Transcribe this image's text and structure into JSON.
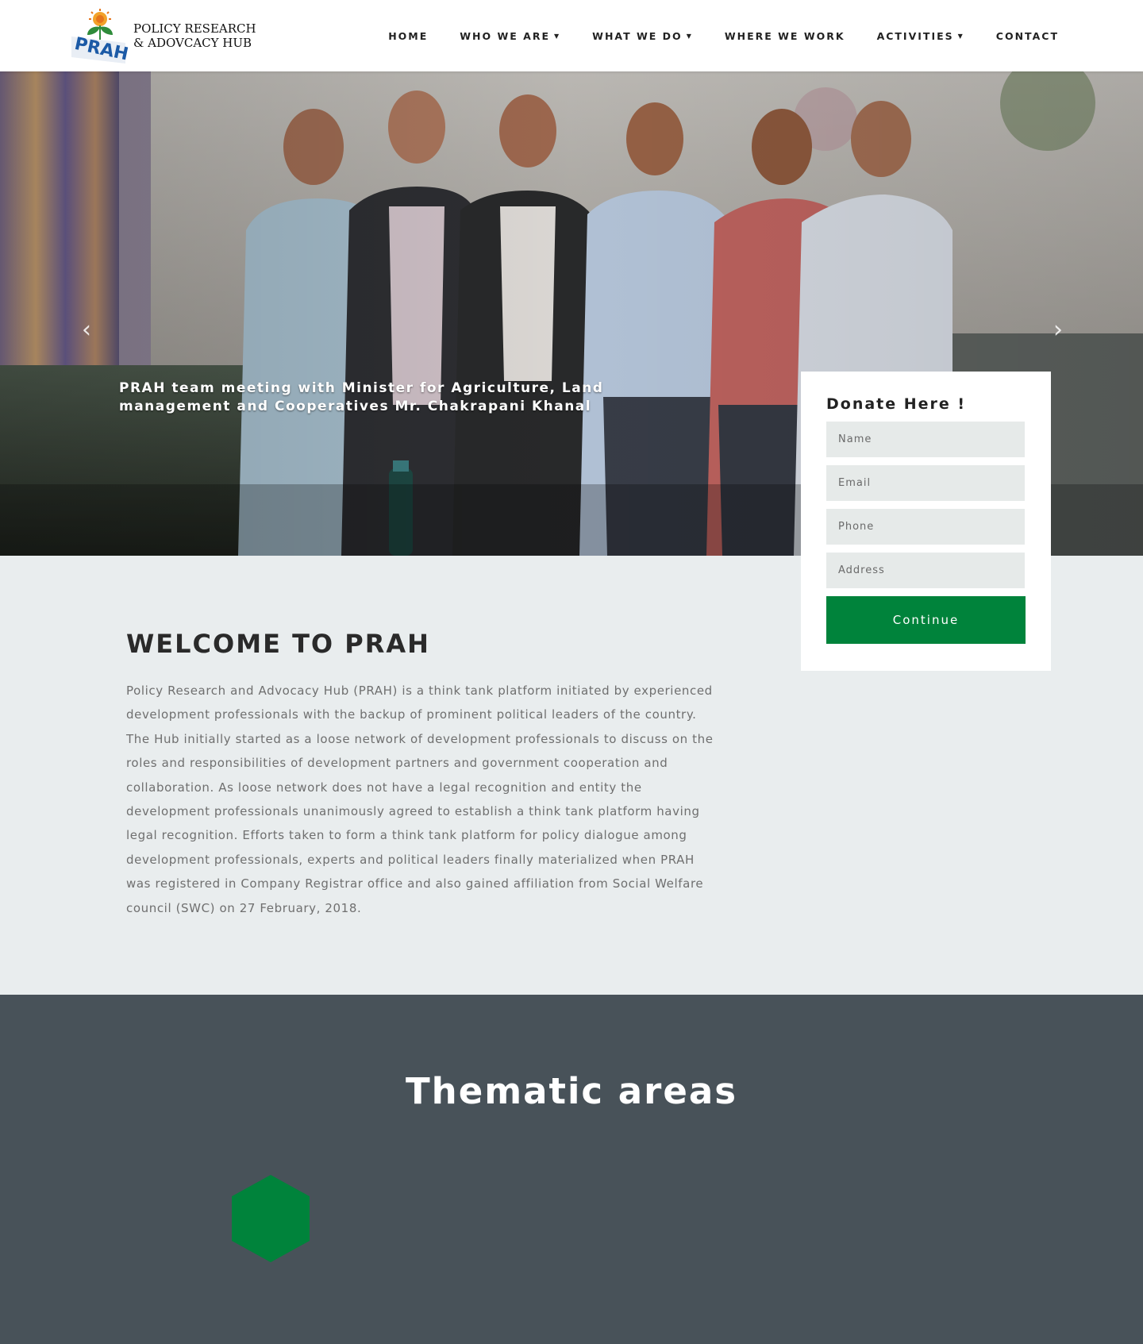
{
  "brand": {
    "logo_text": "PRAH",
    "name_line1": "POLICY RESEARCH",
    "name_line2": "& ADOVCACY HUB"
  },
  "nav": {
    "items": [
      {
        "label": "HOME",
        "dropdown": false
      },
      {
        "label": "WHO WE ARE",
        "dropdown": true
      },
      {
        "label": "WHAT WE DO",
        "dropdown": true
      },
      {
        "label": "WHERE WE WORK",
        "dropdown": false
      },
      {
        "label": "ACTIVITIES",
        "dropdown": true
      },
      {
        "label": "CONTACT",
        "dropdown": false
      }
    ],
    "chevron_glyph": "❯"
  },
  "hero": {
    "caption": "PRAH team meeting with Minister for Agriculture, Land management and Cooperatives Mr. Chakrapani Khanal",
    "prev_icon": "chevron-left-icon",
    "next_icon": "chevron-right-icon"
  },
  "donate": {
    "title": "Donate Here !",
    "fields": {
      "name_placeholder": "Name",
      "email_placeholder": "Email",
      "phone_placeholder": "Phone",
      "address_placeholder": "Address"
    },
    "submit_label": "Continue"
  },
  "welcome": {
    "heading": "WELCOME TO PRAH",
    "body": "Policy Research and Advocacy Hub (PRAH) is a think tank platform initiated by experienced development professionals with the backup of prominent political leaders of the country. The Hub initially started as a loose network of development professionals to discuss on the roles and responsibilities of development partners and government cooperation and collaboration. As loose network does not have a legal recognition and entity the development professionals unanimously agreed to establish a think tank platform having legal recognition. Efforts taken to form a think tank platform for policy dialogue among development professionals, experts and political leaders finally materialized when PRAH was registered in Company Registrar office and also gained affiliation from Social Welfare council (SWC) on 27 February, 2018."
  },
  "thematic": {
    "heading": "Thematic areas"
  },
  "colors": {
    "accent_green": "#00833b",
    "dark_section": "#485259",
    "light_section": "#e9edee"
  }
}
